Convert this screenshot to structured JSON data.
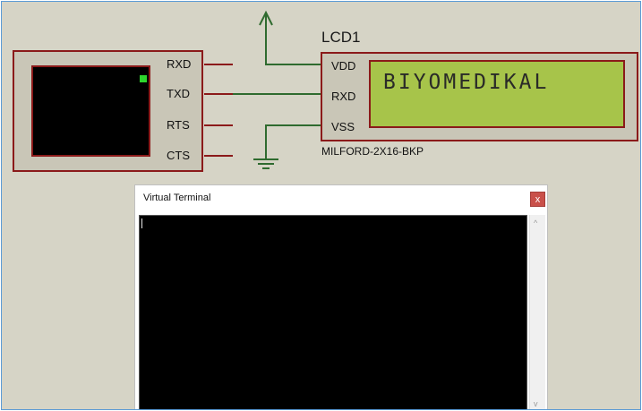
{
  "schematic": {
    "terminal_pins": [
      "RXD",
      "TXD",
      "RTS",
      "CTS"
    ],
    "lcd": {
      "reference": "LCD1",
      "part": "MILFORD-2X16-BKP",
      "pins": [
        "VDD",
        "RXD",
        "VSS"
      ],
      "display_text": "BIYOMEDIKAL"
    },
    "colors": {
      "wire": "#2f6b2f",
      "component_border": "#8b1a1a",
      "lcd_screen": "#a7c44a",
      "led": "#2dd62d"
    }
  },
  "terminal_window": {
    "title": "Virtual Terminal",
    "close_label": "x",
    "scroll_up": "^",
    "scroll_down": "v"
  }
}
